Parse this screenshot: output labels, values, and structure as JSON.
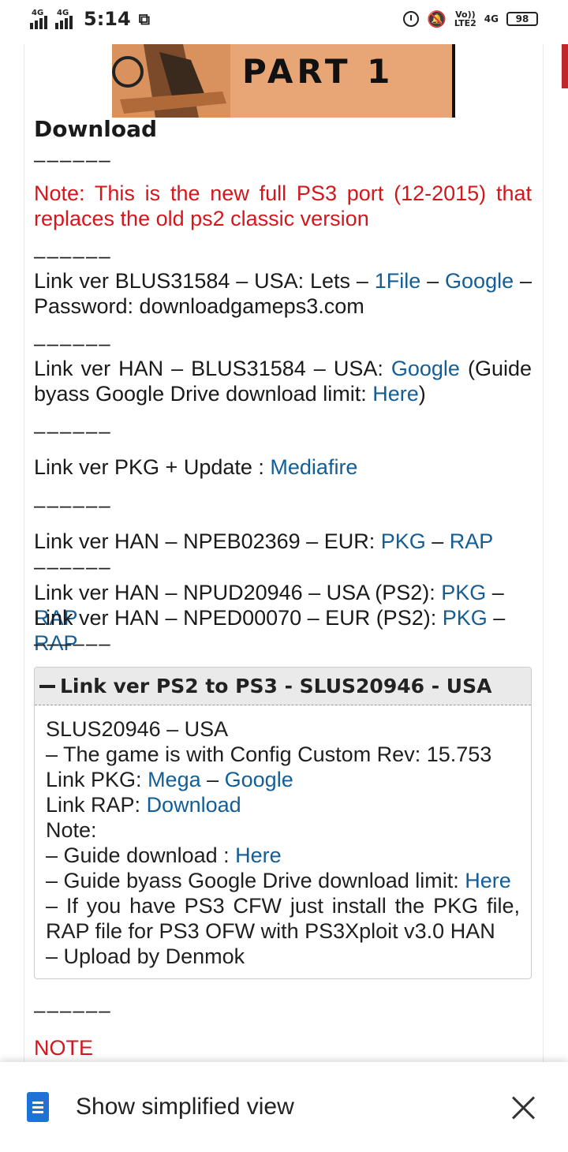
{
  "status_bar": {
    "net1": "4G",
    "net2": "4G",
    "time": "5:14",
    "volte": "Vo))",
    "lte": "LTE2",
    "net_right": "4G",
    "battery": "98"
  },
  "article": {
    "banner_text": "PART 1",
    "heading": "Download",
    "dashes": "––––––",
    "note": "Note: This is the new full PS3 port (12-2015) that replaces the old ps2 classic version",
    "link1": {
      "prefix": "Link ver BLUS31584 – USA: Lets – ",
      "a1": "1File",
      "sep": " – ",
      "a2": "Google",
      "suffix": " – Password: downloadgameps3.com"
    },
    "link2": {
      "prefix": "Link ver HAN – BLUS31584 – USA: ",
      "a1": "Google",
      "mid": " (Guide byass Google Drive download limit: ",
      "a2": "Here",
      "suffix": ")"
    },
    "link3": {
      "prefix": "Link ver PKG + Update : ",
      "a1": "Mediafire"
    },
    "link4": {
      "prefix": "Link ver HAN – NPEB02369 – EUR: ",
      "a1": "PKG",
      "sep": " – ",
      "a2": "RAP"
    },
    "link5": {
      "prefix": "Link ver HAN – NPUD20946 – USA (PS2): ",
      "a1": "PKG",
      "sep": " – ",
      "a2": "RAP"
    },
    "link6": {
      "prefix": "Link ver HAN – NPED00070 – EUR (PS2): ",
      "a1": "PKG",
      "sep": " – ",
      "a2": "RAP"
    },
    "spoiler": {
      "title": "Link ver PS2 to PS3 - SLUS20946 - USA",
      "line1": "SLUS20946 – USA",
      "line2": "– The game is with Config Custom Rev: 15.753",
      "pkg_prefix": "Link PKG: ",
      "pkg_a1": "Mega",
      "pkg_sep": " – ",
      "pkg_a2": "Google",
      "rap_prefix": "Link RAP: ",
      "rap_a1": "Download",
      "note": "Note:",
      "guide1_prefix": "– Guide download : ",
      "guide1_link": "Here",
      "guide2_prefix": "– Guide byass Google Drive download limit: ",
      "guide2_link": "Here",
      "cfw": "– If you have PS3 CFW just install the PKG file, RAP file for PS3 OFW with PS3Xploit v3.0 HAN",
      "upload": "– Upload by Denmok"
    },
    "note_heading": "NOTE"
  },
  "bottom_bar": {
    "label": "Show simplified view"
  }
}
